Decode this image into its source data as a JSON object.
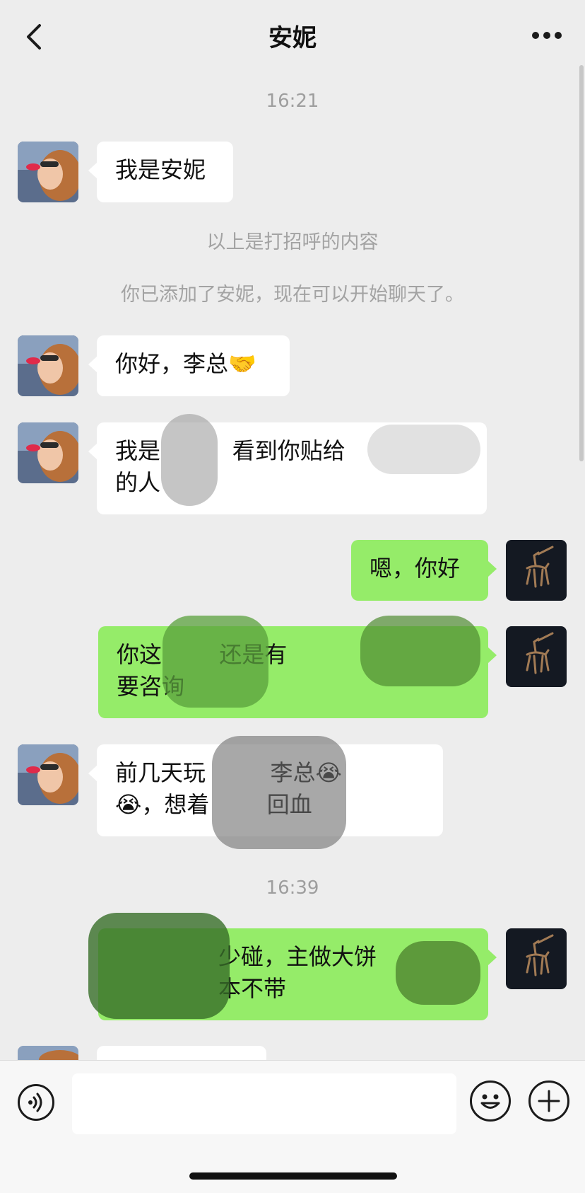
{
  "header": {
    "title": "安妮"
  },
  "timestamps": [
    "16:21",
    "16:39"
  ],
  "system_messages": [
    "以上是打招呼的内容",
    "你已添加了安妮，现在可以开始聊天了。"
  ],
  "messages": [
    {
      "side": "in",
      "text": "我是安妮"
    },
    {
      "side": "in",
      "text": "你好，李总🤝"
    },
    {
      "side": "in",
      "text": "我是          看到你贴给\n的人"
    },
    {
      "side": "out",
      "text": "嗯，你好"
    },
    {
      "side": "out",
      "text": "你这        还是有\n要咨询"
    },
    {
      "side": "in",
      "text": "前几天玩         李总😭\n😭，想着        回血"
    },
    {
      "side": "out",
      "text": "少碰，主做大饼\n本不带"
    }
  ],
  "input": {
    "value": ""
  },
  "colors": {
    "incoming_bubble": "#ffffff",
    "outgoing_bubble": "#95ec69",
    "background": "#ededed"
  },
  "icons": {
    "back": "chevron-left-icon",
    "more": "more-dots-icon",
    "voice": "voice-icon",
    "emoji": "emoji-icon",
    "plus": "plus-icon"
  }
}
